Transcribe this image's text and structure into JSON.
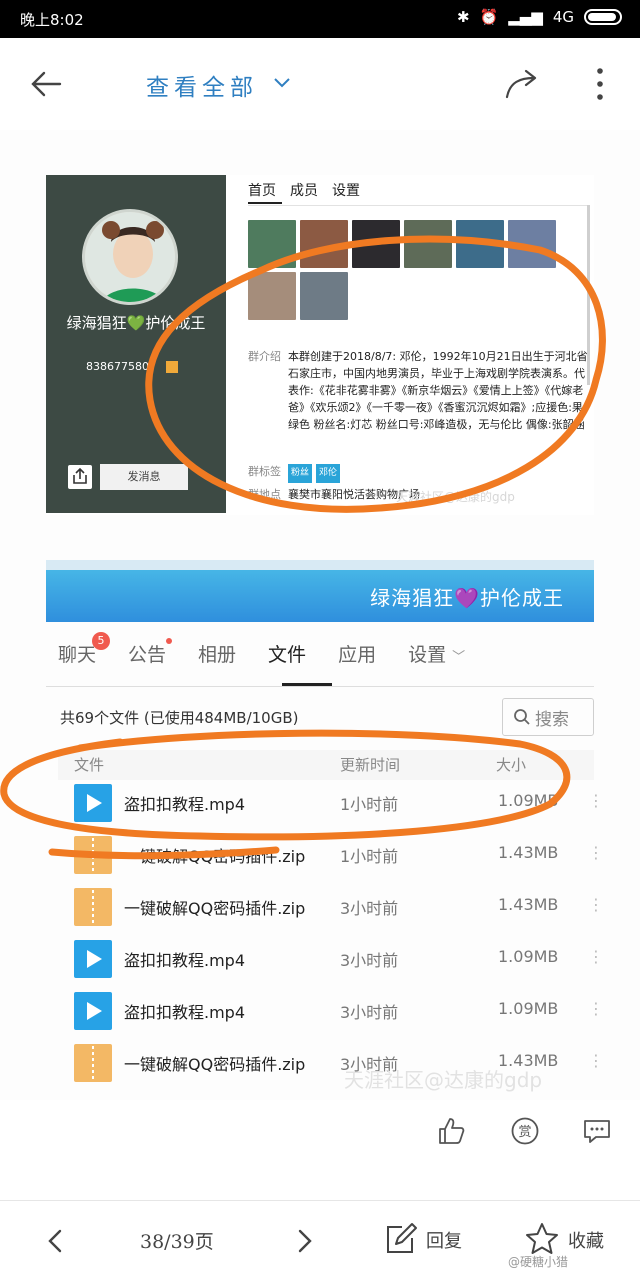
{
  "status_bar": {
    "time": "晚上8:02",
    "network": "4G"
  },
  "header": {
    "title": "查看全部"
  },
  "group_card": {
    "name": "绿海猖狂💚护伦成王",
    "id": "838677580",
    "send_message_label": "发消息",
    "tabs": [
      "首页",
      "成员",
      "设置"
    ],
    "intro_label": "群介绍",
    "intro_text": "本群创建于2018/8/7: 邓伦，1992年10月21日出生于河北省石家庄市，中国内地男演员，毕业于上海戏剧学院表演系。代表作:《花非花雾非雾》《新京华烟云》《爱情上上签》《代嫁老爸》《欢乐颂2》《一千零一夜》《香蜜沉沉烬如霜》;应援色:果绿色  粉丝名:灯芯   粉丝口号:邓峰造极，无与伦比  偶像:张韶涵",
    "tags_label": "群标签",
    "tags": [
      "粉丝",
      "邓伦"
    ],
    "location_label": "群地点",
    "location": "襄樊市襄阳悦活荟购物广场",
    "watermark": "天涯社区@达康的gdp"
  },
  "banner": {
    "text": "绿海猖狂💜护伦成王"
  },
  "file_tabs": [
    {
      "label": "聊天",
      "badge": "5"
    },
    {
      "label": "公告",
      "dot": true
    },
    {
      "label": "相册"
    },
    {
      "label": "文件",
      "active": true
    },
    {
      "label": "应用"
    },
    {
      "label": "设置"
    }
  ],
  "files": {
    "summary": "共69个文件 (已使用484MB/10GB)",
    "search_placeholder": "搜索",
    "columns": {
      "name": "文件",
      "time": "更新时间",
      "size": "大小"
    },
    "rows": [
      {
        "type": "video",
        "name": "盗扣扣教程.mp4",
        "time": "1小时前",
        "size": "1.09MB"
      },
      {
        "type": "zip",
        "name": "一键破解QQ密码插件.zip",
        "time": "1小时前",
        "size": "1.43MB"
      },
      {
        "type": "zip",
        "name": "一键破解QQ密码插件.zip",
        "time": "3小时前",
        "size": "1.43MB"
      },
      {
        "type": "video",
        "name": "盗扣扣教程.mp4",
        "time": "3小时前",
        "size": "1.09MB"
      },
      {
        "type": "video",
        "name": "盗扣扣教程.mp4",
        "time": "3小时前",
        "size": "1.09MB"
      },
      {
        "type": "zip",
        "name": "一键破解QQ密码插件.zip",
        "time": "3小时前",
        "size": "1.43MB"
      }
    ],
    "watermark": "天涯社区@达康的gdp"
  },
  "bottom_bar": {
    "page_indicator": "38/39页",
    "reply_label": "回复",
    "favorite_label": "收藏",
    "weibo_watermark": "@硬糖小猎"
  },
  "colors": {
    "accent": "#2f7fc1",
    "annotation_orange": "#f07a22",
    "video_icon": "#27a2e6",
    "zip_icon": "#f3b865"
  }
}
